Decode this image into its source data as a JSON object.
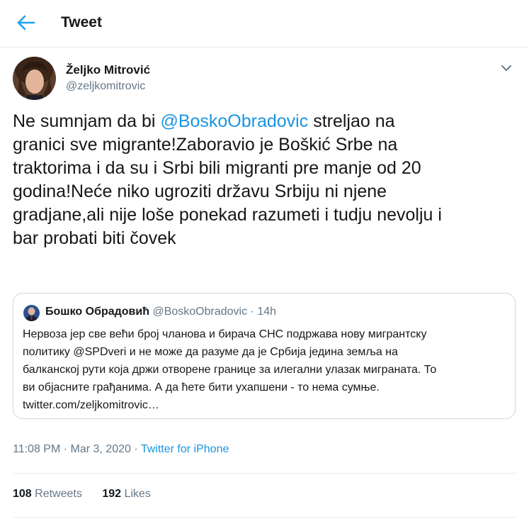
{
  "header": {
    "title": "Tweet",
    "back_icon": "arrow-left-icon",
    "accent": "#1da1f2"
  },
  "tweet": {
    "author_name": "Željko Mitrović",
    "author_handle": "@zeljkomitrovic",
    "more_icon": "chevron-down-icon",
    "text_lines": [
      [
        "Ne sumnjam da bi ",
        "@BoskoObradovic",
        "  streljao na"
      ],
      "granici sve migrante!Zaboravio je Boškić Srbe na",
      "traktorima i da su i Srbi bili migranti pre manje od 20",
      "godina!Neće niko ugroziti državu Srbiju ni njene",
      "gradjane,ali nije loše ponekad razumeti i tudju nevolju i",
      "bar probati biti čovek"
    ],
    "time": "11:08 PM",
    "date": "Mar 3, 2020",
    "source": "Twitter for iPhone",
    "retweets_count": "108",
    "retweets_label": "Retweets",
    "likes_count": "192",
    "likes_label": "Likes",
    "link_color": "#1b95e0"
  },
  "quote": {
    "name": "Бошко Обрадовић",
    "handle": "@BoskoObradovic",
    "time": "14h",
    "text_lines": [
      "Нервоза јер све већи број чланова и бирача СНС подржава нову мигрантску",
      "политику @SPDveri и не може да разуме да је Србија једина земља на",
      "балканској рути која држи отворене границе за илегални улазак миграната. То",
      "ви објасните грађанима. А да ћете бити ухапшени - то нема сумње.",
      "twitter.com/zeljkomitrovic…"
    ]
  }
}
